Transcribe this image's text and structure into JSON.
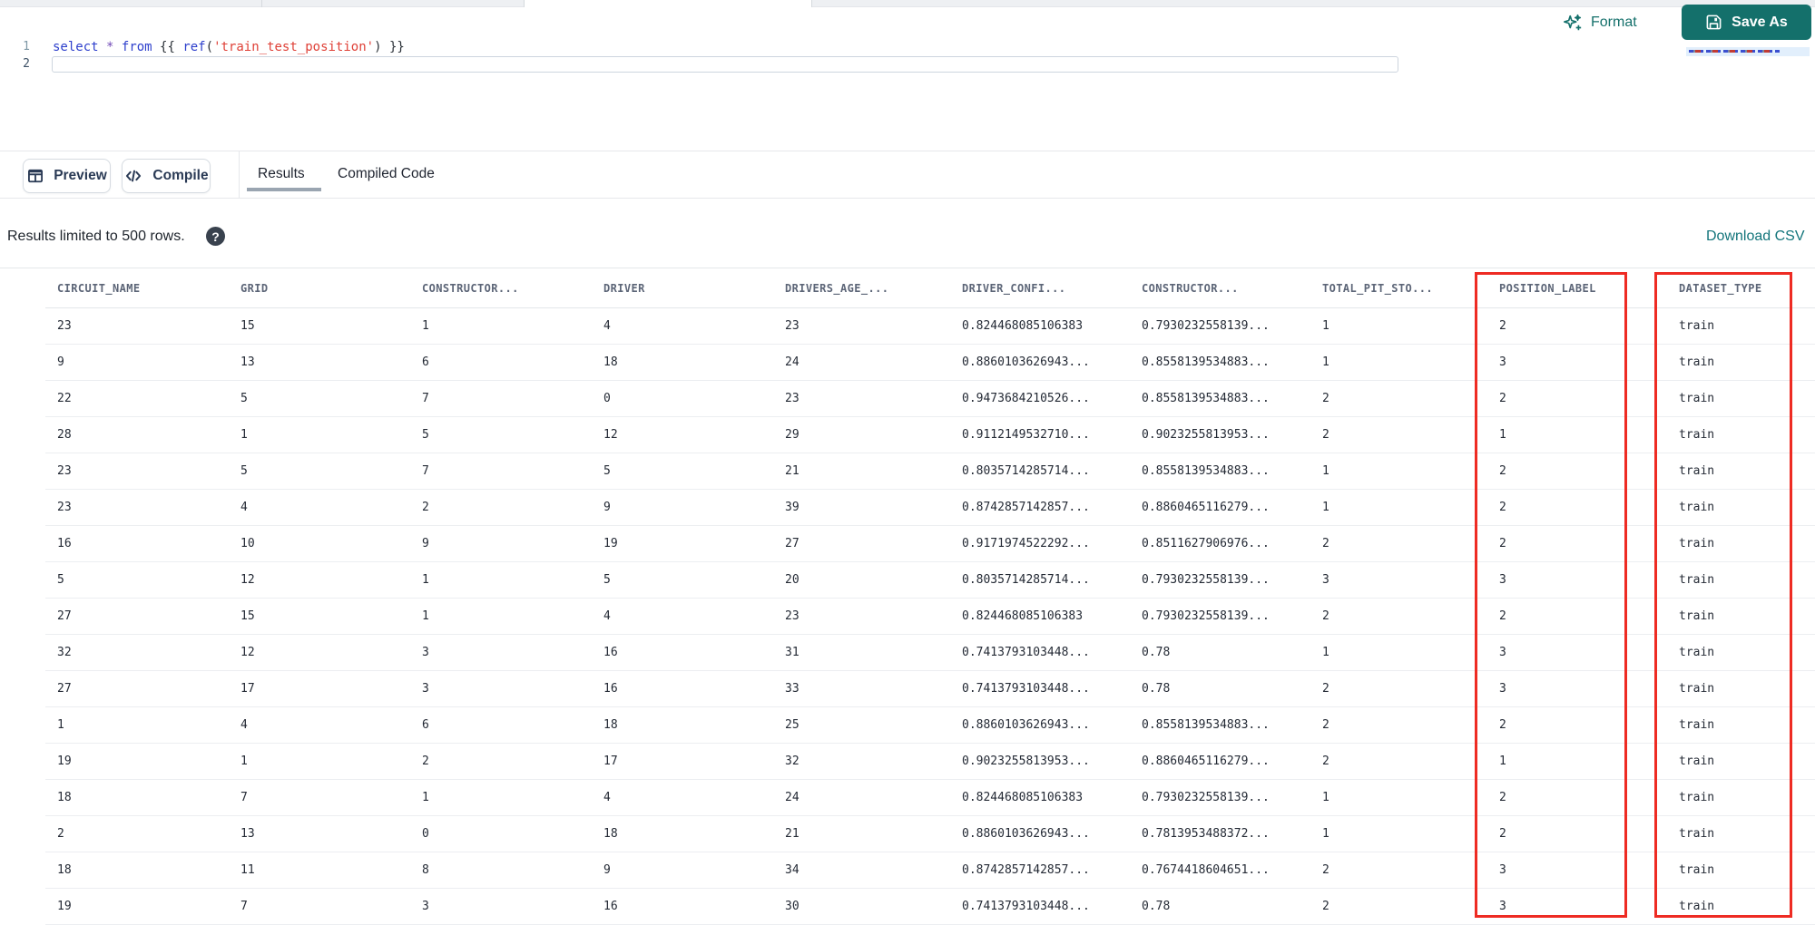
{
  "editor": {
    "lines": [
      {
        "number": "1",
        "tokens": [
          {
            "text": "select",
            "type": "keyword"
          },
          {
            "text": " ",
            "type": "plain"
          },
          {
            "text": "*",
            "type": "operator"
          },
          {
            "text": " ",
            "type": "plain"
          },
          {
            "text": "from",
            "type": "keyword"
          },
          {
            "text": " {{ ",
            "type": "plain"
          },
          {
            "text": "ref",
            "type": "function"
          },
          {
            "text": "(",
            "type": "plain"
          },
          {
            "text": "'train_test_position'",
            "type": "string"
          },
          {
            "text": ")",
            "type": "plain"
          },
          {
            "text": " }}",
            "type": "plain"
          }
        ]
      },
      {
        "number": "2",
        "tokens": []
      }
    ]
  },
  "toolbar": {
    "format_label": "Format",
    "save_as_label": "Save As"
  },
  "actions": {
    "preview_label": "Preview",
    "compile_label": "Compile"
  },
  "tabs": [
    {
      "label": "Results",
      "active": true
    },
    {
      "label": "Compiled Code",
      "active": false
    }
  ],
  "results_bar": {
    "message": "Results limited to 500 rows.",
    "help_glyph": "?",
    "download_label": "Download CSV"
  },
  "table": {
    "columns": [
      "CIRCUIT_NAME",
      "GRID",
      "CONSTRUCTOR...",
      "DRIVER",
      "DRIVERS_AGE_...",
      "DRIVER_CONFI...",
      "CONSTRUCTOR...",
      "TOTAL_PIT_STO...",
      "POSITION_LABEL",
      "DATASET_TYPE"
    ],
    "rows": [
      [
        "23",
        "15",
        "1",
        "4",
        "23",
        "0.824468085106383",
        "0.7930232558139...",
        "1",
        "2",
        "train"
      ],
      [
        "9",
        "13",
        "6",
        "18",
        "24",
        "0.8860103626943...",
        "0.8558139534883...",
        "1",
        "3",
        "train"
      ],
      [
        "22",
        "5",
        "7",
        "0",
        "23",
        "0.9473684210526...",
        "0.8558139534883...",
        "2",
        "2",
        "train"
      ],
      [
        "28",
        "1",
        "5",
        "12",
        "29",
        "0.9112149532710...",
        "0.9023255813953...",
        "2",
        "1",
        "train"
      ],
      [
        "23",
        "5",
        "7",
        "5",
        "21",
        "0.8035714285714...",
        "0.8558139534883...",
        "1",
        "2",
        "train"
      ],
      [
        "23",
        "4",
        "2",
        "9",
        "39",
        "0.8742857142857...",
        "0.8860465116279...",
        "1",
        "2",
        "train"
      ],
      [
        "16",
        "10",
        "9",
        "19",
        "27",
        "0.9171974522292...",
        "0.8511627906976...",
        "2",
        "2",
        "train"
      ],
      [
        "5",
        "12",
        "1",
        "5",
        "20",
        "0.8035714285714...",
        "0.7930232558139...",
        "3",
        "3",
        "train"
      ],
      [
        "27",
        "15",
        "1",
        "4",
        "23",
        "0.824468085106383",
        "0.7930232558139...",
        "2",
        "2",
        "train"
      ],
      [
        "32",
        "12",
        "3",
        "16",
        "31",
        "0.7413793103448...",
        "0.78",
        "1",
        "3",
        "train"
      ],
      [
        "27",
        "17",
        "3",
        "16",
        "33",
        "0.7413793103448...",
        "0.78",
        "2",
        "3",
        "train"
      ],
      [
        "1",
        "4",
        "6",
        "18",
        "25",
        "0.8860103626943...",
        "0.8558139534883...",
        "2",
        "2",
        "train"
      ],
      [
        "19",
        "1",
        "2",
        "17",
        "32",
        "0.9023255813953...",
        "0.8860465116279...",
        "2",
        "1",
        "train"
      ],
      [
        "18",
        "7",
        "1",
        "4",
        "24",
        "0.824468085106383",
        "0.7930232558139...",
        "1",
        "2",
        "train"
      ],
      [
        "2",
        "13",
        "0",
        "18",
        "21",
        "0.8860103626943...",
        "0.7813953488372...",
        "1",
        "2",
        "train"
      ],
      [
        "18",
        "11",
        "8",
        "9",
        "34",
        "0.8742857142857...",
        "0.7674418604651...",
        "2",
        "3",
        "train"
      ],
      [
        "19",
        "7",
        "3",
        "16",
        "30",
        "0.7413793103448...",
        "0.78",
        "2",
        "3",
        "train"
      ]
    ],
    "highlighted_columns": [
      "POSITION_LABEL",
      "DATASET_TYPE"
    ]
  },
  "colors": {
    "accent_teal": "#14706b",
    "keyword_blue": "#2d3fcc",
    "operator_purple": "#7048b6",
    "string_red": "#df4037",
    "annotation_red": "#ee2b23",
    "tab_underline": "#9aa5b1"
  }
}
